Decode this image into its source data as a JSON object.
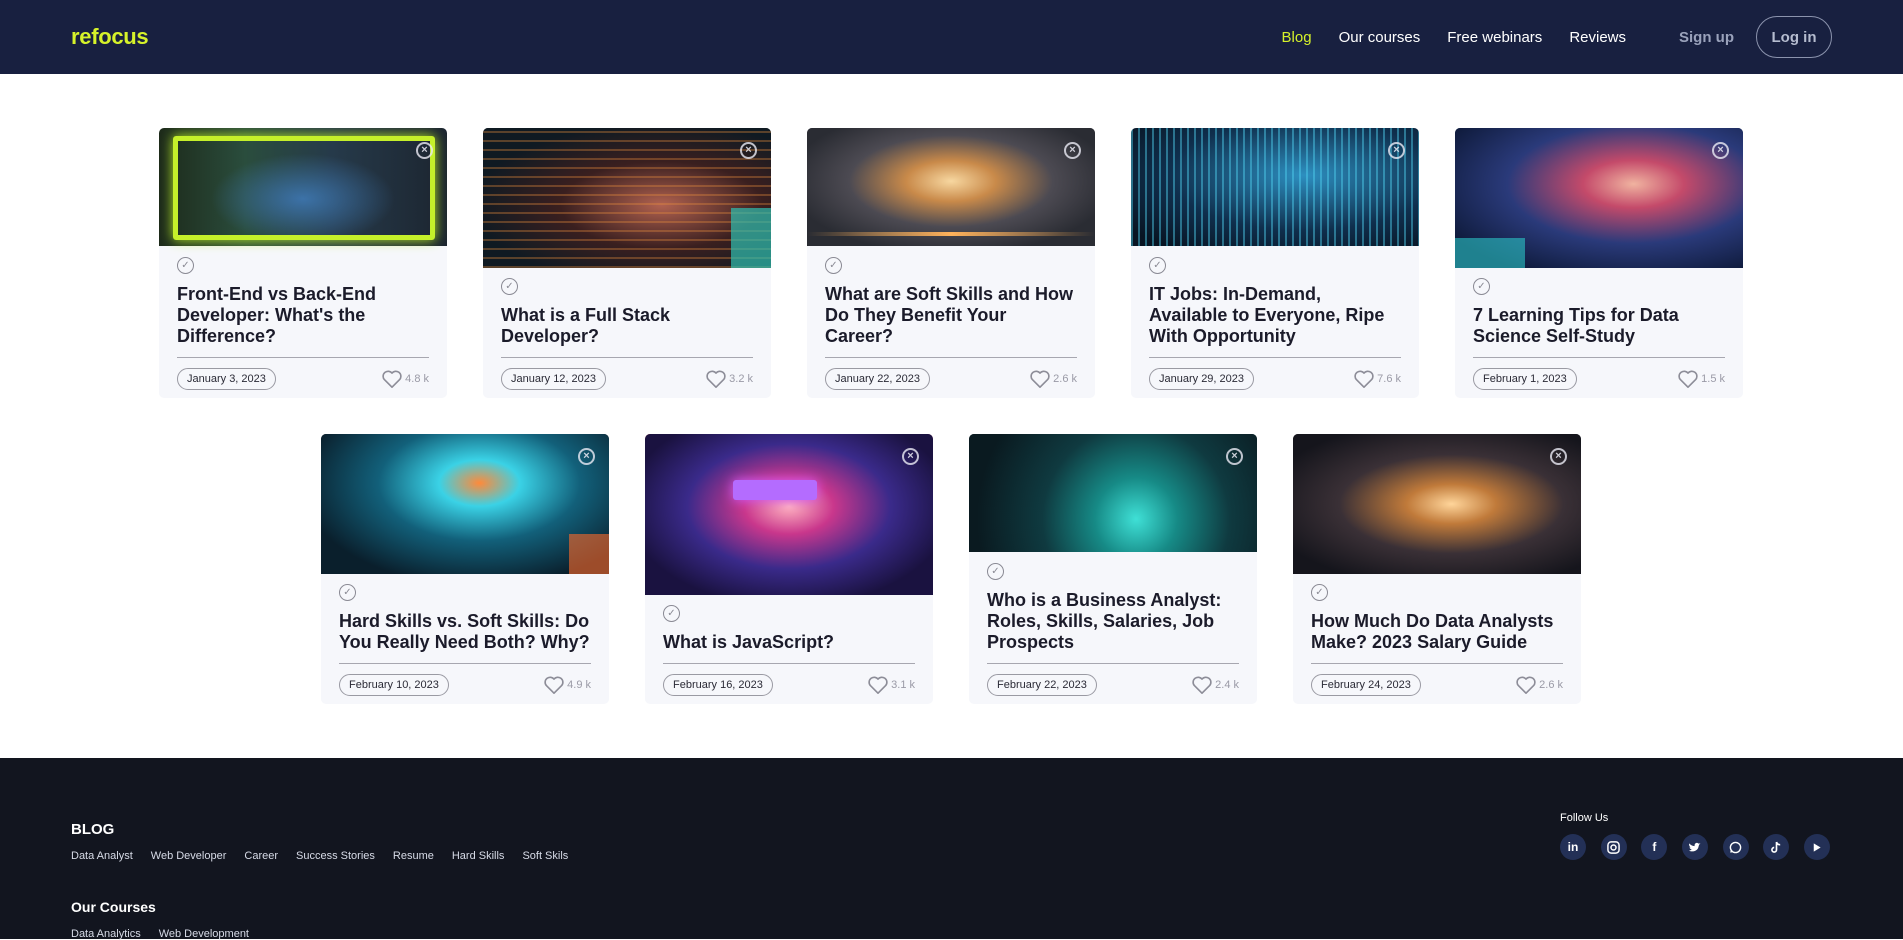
{
  "header": {
    "logo": "refocus",
    "nav": [
      "Blog",
      "Our courses",
      "Free webinars",
      "Reviews"
    ],
    "signup": "Sign up",
    "login": "Log in"
  },
  "posts": [
    {
      "title": "Front-End vs Back-End Developer: What's the Difference?",
      "date": "January 3, 2023",
      "likes": "4.8 k"
    },
    {
      "title": "What is a Full Stack Developer?",
      "date": "January 12, 2023",
      "likes": "3.2 k"
    },
    {
      "title": "What are Soft Skills and How Do They Benefit Your Career?",
      "date": "January 22, 2023",
      "likes": "2.6 k"
    },
    {
      "title": "IT Jobs: In-Demand, Available to Everyone, Ripe With Opportunity",
      "date": "January 29, 2023",
      "likes": "7.6 k"
    },
    {
      "title": "7 Learning Tips for Data Science Self-Study",
      "date": "February 1, 2023",
      "likes": "1.5 k"
    },
    {
      "title": "Hard Skills vs. Soft Skills: Do You Really Need Both? Why?",
      "date": "February 10, 2023",
      "likes": "4.9 k"
    },
    {
      "title": "What is JavaScript?",
      "date": "February 16, 2023",
      "likes": "3.1 k"
    },
    {
      "title": "Who is a Business Analyst: Roles, Skills, Salaries, Job Prospects",
      "date": "February 22, 2023",
      "likes": "2.4 k"
    },
    {
      "title": "How Much Do Data Analysts Make? 2023 Salary Guide",
      "date": "February 24, 2023",
      "likes": "2.6 k"
    }
  ],
  "footer": {
    "blog_heading": "BLOG",
    "blog_links": [
      "Data Analyst",
      "Web Developer",
      "Career",
      "Success Stories",
      "Resume",
      "Hard Skills",
      "Soft Skils"
    ],
    "courses_heading": "Our Courses",
    "course_links": [
      "Data Analytics",
      "Web Development"
    ],
    "follow_label": "Follow Us",
    "socials": [
      "linkedin-icon",
      "instagram-icon",
      "facebook-icon",
      "twitter-icon",
      "whatsapp-icon",
      "tiktok-icon",
      "youtube-icon"
    ]
  }
}
